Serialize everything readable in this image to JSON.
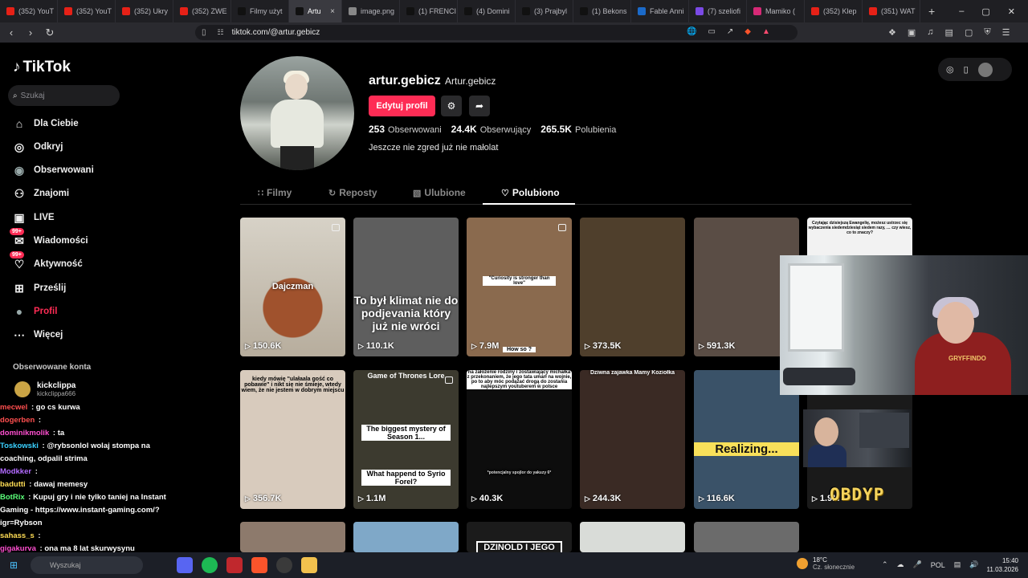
{
  "browser": {
    "tabs": [
      {
        "label": "(352) YouT",
        "color": "#e62117"
      },
      {
        "label": "(352) YouT",
        "color": "#e62117"
      },
      {
        "label": "(352) Ukry",
        "color": "#e62117"
      },
      {
        "label": "(352) ZWE",
        "color": "#e62117"
      },
      {
        "label": "Filmy użyt",
        "color": "#111111"
      },
      {
        "label": "Artu",
        "color": "#111111",
        "active": true
      },
      {
        "label": "image.png",
        "color": "#888888"
      },
      {
        "label": "(1) FRENCI",
        "color": "#111111"
      },
      {
        "label": "(4) Domini",
        "color": "#111111"
      },
      {
        "label": "(3) Prajbyl",
        "color": "#111111"
      },
      {
        "label": "(1) Bekons",
        "color": "#111111"
      },
      {
        "label": "Fable Anni",
        "color": "#1b6ac9"
      },
      {
        "label": "(7) szeliofi",
        "color": "#7b4ae6"
      },
      {
        "label": "Mamiko (",
        "color": "#d62976"
      },
      {
        "label": "(352) Klep",
        "color": "#e62117"
      },
      {
        "label": "(351) WAT",
        "color": "#e62117"
      }
    ],
    "new_tab": "+",
    "url": "tiktok.com/@artur.gebicz"
  },
  "sidebar": {
    "logo": "TikTok",
    "search_placeholder": "Szukaj",
    "items": [
      {
        "label": "Dla Ciebie",
        "icon": "home-icon"
      },
      {
        "label": "Odkryj",
        "icon": "compass-icon"
      },
      {
        "label": "Obserwowani",
        "icon": "following-avatar-icon"
      },
      {
        "label": "Znajomi",
        "icon": "friends-icon"
      },
      {
        "label": "LIVE",
        "icon": "live-icon"
      },
      {
        "label": "Wiadomości",
        "icon": "messages-icon",
        "badge": "99+"
      },
      {
        "label": "Aktywność",
        "icon": "activity-icon",
        "badge": "99+"
      },
      {
        "label": "Prześlij",
        "icon": "upload-icon"
      },
      {
        "label": "Profil",
        "icon": "profile-icon",
        "active": true
      },
      {
        "label": "Więcej",
        "icon": "more-icon"
      }
    ],
    "followed_title": "Obserwowane konta",
    "followed": [
      {
        "name": "kickclippa",
        "handle": "kickclippa666"
      }
    ]
  },
  "chat": [
    {
      "user": "mecwel",
      "msg": "go cs kurwa",
      "color": "#ff4f4f"
    },
    {
      "user": "dogerben",
      "msg": "",
      "color": "#ff4f4f"
    },
    {
      "user": "dominikmolik",
      "msg": "ta",
      "color": "#ff4fd0"
    },
    {
      "user": "Toskowski",
      "msg": "@rybsonlol wolaj stompa na coaching, odpalil strima",
      "color": "#3ad1ff"
    },
    {
      "user": "Modkker",
      "msg": "",
      "color": "#b36bff"
    },
    {
      "user": "badutti",
      "msg": "dawaj memesy",
      "color": "#ffdd55"
    },
    {
      "user": "BotRix",
      "msg": "Kupuj gry i nie tylko taniej na Instant Gaming - https://www.instant-gaming.com/?igr=Rybson",
      "color": "#5bff7a"
    },
    {
      "user": "sahass_s",
      "msg": "",
      "color": "#ffdd55"
    },
    {
      "user": "gigakurva",
      "msg": "ona ma 8 lat skurwysynu",
      "color": "#ff4fd0"
    }
  ],
  "profile": {
    "username": "artur.gebicz",
    "nickname": "Artur.gebicz",
    "edit_label": "Edytuj profil",
    "stats": [
      {
        "value": "253",
        "label": "Obserwowani"
      },
      {
        "value": "24.4K",
        "label": "Obserwujący"
      },
      {
        "value": "265.5K",
        "label": "Polubienia"
      }
    ],
    "bio": "Jeszcze nie zgred już nie małolat",
    "tabs": [
      {
        "label": "Filmy",
        "icon": "grid-icon"
      },
      {
        "label": "Reposty",
        "icon": "repost-icon"
      },
      {
        "label": "Ulubione",
        "icon": "bookmark-icon"
      },
      {
        "label": "Polubiono",
        "icon": "heart-icon",
        "active": true
      }
    ]
  },
  "videos": [
    {
      "views": "150.6K",
      "caption": "Dajczman",
      "bg": "#c9c2b5"
    },
    {
      "views": "110.1K",
      "caption": "To był klimat nie do podjevania który już nie wróci",
      "bg": "#5e5e5e"
    },
    {
      "views": "7.9M",
      "caption": "\"Curiosity is stronger than love\"",
      "caption2": "How so ?",
      "bg": "#8a6a4e"
    },
    {
      "views": "373.5K",
      "caption": "",
      "bg": "#4f3f2c"
    },
    {
      "views": "591.3K",
      "caption": "",
      "bg": "#5a4d45"
    },
    {
      "views": "",
      "caption": "Czytając dzisiejszą Ewangelię, możesz ustrzec się wybaczenia siedemdziesiąt siedem razy, … czy wiesz, co to znaczy?",
      "bg": "#f2f2f2"
    },
    {
      "views": "356.7K",
      "caption": "kiedy mówię \"ulałaala gość co pobawie\" i nikt się nie śmieje, wtedy wiem, że nie jestem w dobrym miejscu",
      "bg": "#d8cbbd"
    },
    {
      "views": "1.1M",
      "caption": "Game of Thrones Lore",
      "caption2": "The biggest mystery of Season 1...",
      "caption3": "What happend to Syrio Forel?",
      "bg": "#3c3a2f"
    },
    {
      "views": "40.3K",
      "caption": "na założenie rodziny i zostawiający michałka z przekonaniem, że jego tata umarł na wojnie, po to aby móc podążać drogą do zostania najlepszym youtuberem w polsce",
      "caption2": "*potencjalny spojlor do yakuzy 6*",
      "bg": "#0d0d0d"
    },
    {
      "views": "244.3K",
      "caption": "Dziwna zajawka Mamy Koziołka",
      "bg": "#3a2a24"
    },
    {
      "views": "116.6K",
      "caption": "Realizing...",
      "bg": "#3a5268"
    },
    {
      "views": "1.9M",
      "caption": "",
      "bg": "#1a1a1a"
    },
    {
      "views": "",
      "caption": "",
      "bg": "#8d7a6c"
    },
    {
      "views": "",
      "caption": "",
      "bg": "#7fa8c8"
    },
    {
      "views": "",
      "caption": "DZINOLD I JEGO",
      "bg": "#1b1b1b"
    },
    {
      "views": "",
      "caption": "",
      "bg": "#d9dcd8"
    },
    {
      "views": "",
      "caption": "",
      "bg": "#6b6b6b"
    }
  ],
  "overlay": {
    "logo_text": "OBDYP"
  },
  "taskbar": {
    "search_placeholder": "Wyszukaj",
    "weather_temp": "18°C",
    "weather_desc": "Cz. słonecznie",
    "lang": "POL",
    "time": "15:40",
    "date": "11.03.2026"
  }
}
